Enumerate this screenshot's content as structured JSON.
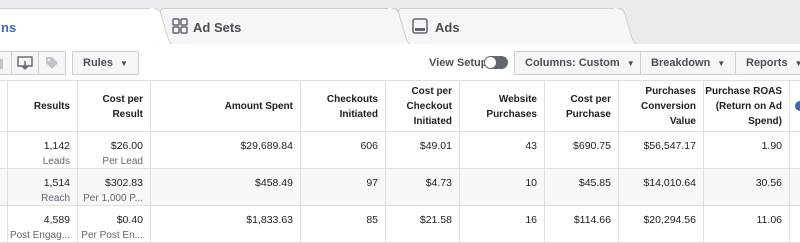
{
  "tabs": [
    {
      "label": "ns",
      "icon": "campaigns-icon"
    },
    {
      "label": "Ad Sets",
      "icon": "ad-sets-icon"
    },
    {
      "label": "Ads",
      "icon": "ads-icon"
    }
  ],
  "toolbar": {
    "rules_label": "Rules",
    "view_setup_label": "View Setup",
    "columns_prefix": "Columns:",
    "columns_value": "Custom",
    "breakdown_label": "Breakdown",
    "reports_label": "Reports"
  },
  "table": {
    "headers": {
      "results": "Results",
      "cost_per_result": "Cost per Result",
      "amount_spent": "Amount Spent",
      "checkouts_initiated": "Checkouts Initiated",
      "cost_per_checkout": "Cost per Checkout Initiated",
      "website_purchases": "Website Purchases",
      "cost_per_purchase": "Cost per Purchase",
      "purchases_conversion_value": "Purchases Conversion Value",
      "purchase_roas": "Purchase ROAS (Return on Ad Spend)"
    },
    "rows": [
      {
        "results": "1,142",
        "results_sub": "Leads",
        "cost_per_result": "$26.00",
        "cost_per_result_sub": "Per Lead",
        "amount_spent": "$29,689.84",
        "checkouts_initiated": "606",
        "cost_per_checkout": "$49.01",
        "website_purchases": "43",
        "cost_per_purchase": "$690.75",
        "purchases_conversion_value": "$56,547.17",
        "purchase_roas": "1.90"
      },
      {
        "results": "1,514",
        "results_sub": "Reach",
        "cost_per_result": "$302.83",
        "cost_per_result_sub": "Per 1,000 P...",
        "amount_spent": "$458.49",
        "checkouts_initiated": "97",
        "cost_per_checkout": "$4.73",
        "website_purchases": "10",
        "cost_per_purchase": "$45.85",
        "purchases_conversion_value": "$14,010.64",
        "purchase_roas": "30.56"
      },
      {
        "results": "4,589",
        "results_sub": "Post Engag...",
        "cost_per_result": "$0.40",
        "cost_per_result_sub": "Per Post En...",
        "amount_spent": "$1,833.63",
        "checkouts_initiated": "85",
        "cost_per_checkout": "$21.58",
        "website_purchases": "16",
        "cost_per_purchase": "$114.66",
        "purchases_conversion_value": "$20,294.56",
        "purchase_roas": "11.06"
      }
    ]
  },
  "colors": {
    "accent": "#4267b2",
    "border": "#dddfe2",
    "tabstrip": "#e9ebee"
  }
}
